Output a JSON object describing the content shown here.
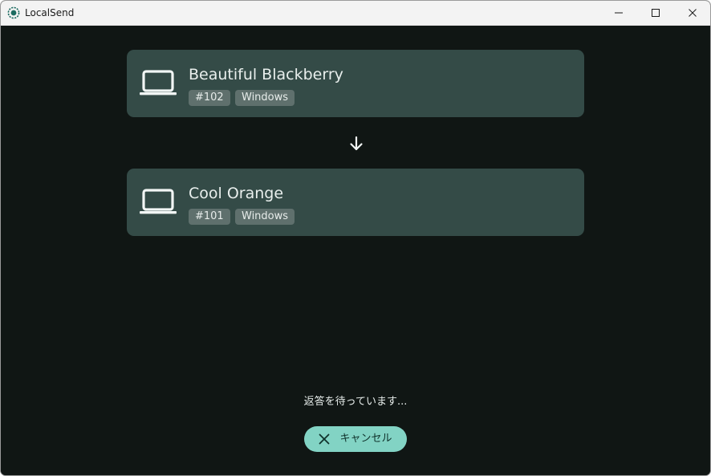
{
  "window": {
    "title": "LocalSend",
    "app_icon": "localsend-logo-icon",
    "controls": [
      "minimize-icon",
      "maximize-icon",
      "close-icon"
    ]
  },
  "sender": {
    "icon": "laptop-icon",
    "name": "Beautiful Blackberry",
    "id_badge": "#102",
    "os_badge": "Windows"
  },
  "direction_icon": "arrow-down-icon",
  "receiver": {
    "icon": "laptop-icon",
    "name": "Cool Orange",
    "id_badge": "#101",
    "os_badge": "Windows"
  },
  "status": {
    "text": "返答を待っています..."
  },
  "cancel_button": {
    "icon": "close-icon",
    "label": "キャンセル"
  },
  "colors": {
    "background": "#101614",
    "card": "#344b47",
    "badge": "#5f706d",
    "accent": "#82d3c4",
    "titlebar": "#f3f3f3"
  }
}
